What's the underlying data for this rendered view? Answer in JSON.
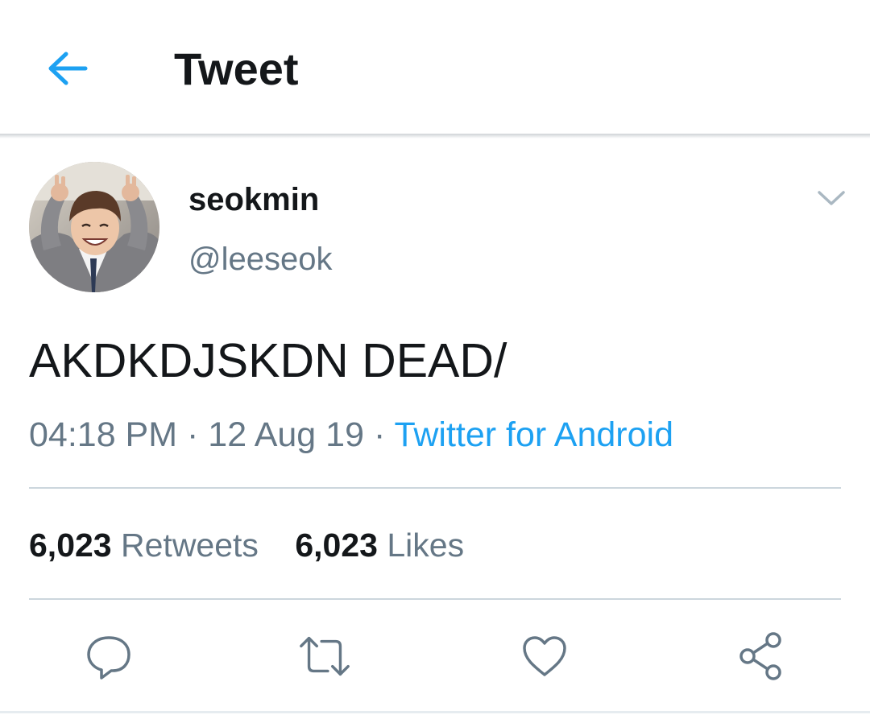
{
  "header": {
    "title": "Tweet",
    "back_icon": "arrow-left-icon",
    "accent": "#1da1f2"
  },
  "tweet": {
    "author": {
      "display_name": "seokmin",
      "handle": "@leeseok"
    },
    "text": "AKDKDJSKDN DEAD/",
    "time": "04:18 PM",
    "date": "12 Aug 19",
    "separator": "·",
    "source": "Twitter for Android",
    "stats": {
      "retweets_count": "6,023",
      "retweets_label": "Retweets",
      "likes_count": "6,023",
      "likes_label": "Likes"
    },
    "actions": [
      "reply-icon",
      "retweet-icon",
      "like-icon",
      "share-icon"
    ]
  },
  "colors": {
    "text_primary": "#14171a",
    "text_secondary": "#657786",
    "link": "#1da1f2",
    "divider": "#ccd6dd"
  }
}
